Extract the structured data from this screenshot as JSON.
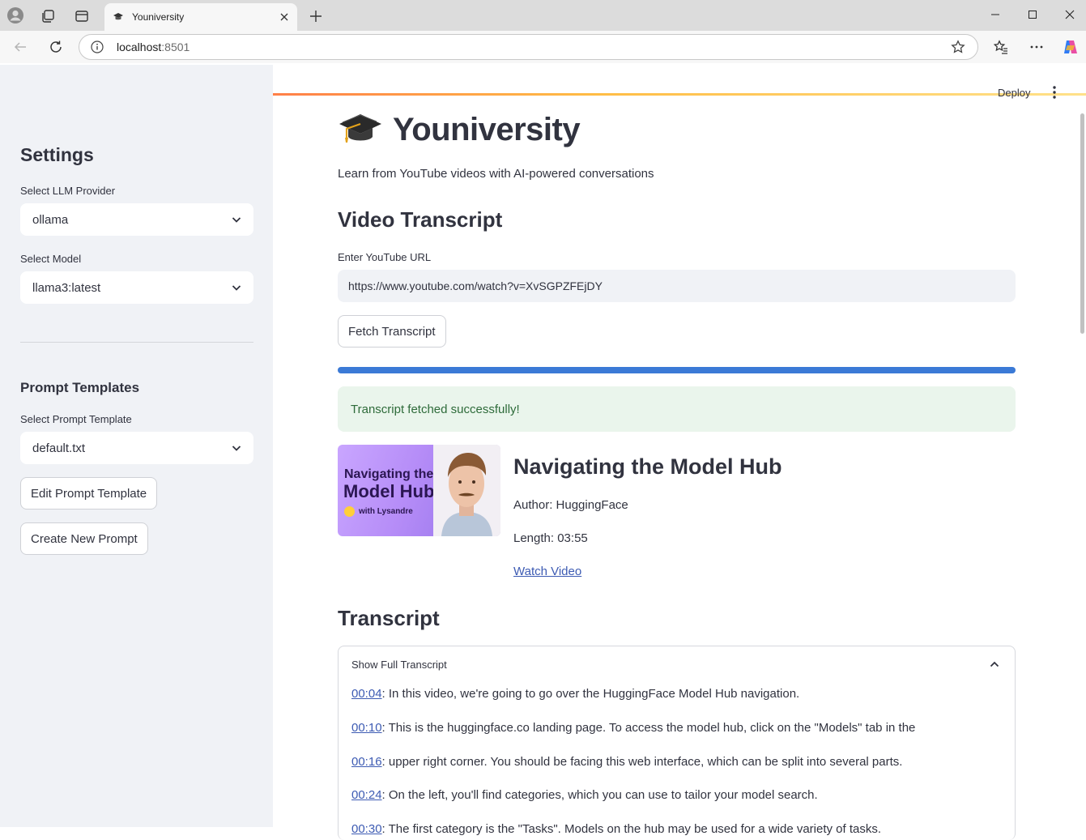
{
  "browser": {
    "tab_title": "Youniversity",
    "url_host": "localhost",
    "url_port": ":8501"
  },
  "sidebar": {
    "settings_heading": "Settings",
    "llm_provider_label": "Select LLM Provider",
    "llm_provider_value": "ollama",
    "model_label": "Select Model",
    "model_value": "llama3:latest",
    "prompt_templates_heading": "Prompt Templates",
    "prompt_template_label": "Select Prompt Template",
    "prompt_template_value": "default.txt",
    "edit_prompt_button": "Edit Prompt Template",
    "create_prompt_button": "Create New Prompt"
  },
  "header": {
    "deploy_label": "Deploy"
  },
  "main": {
    "title": "Youniversity",
    "subtitle": "Learn from YouTube videos with AI-powered conversations",
    "video_transcript_heading": "Video Transcript",
    "url_label": "Enter YouTube URL",
    "url_value": "https://www.youtube.com/watch?v=XvSGPZFEjDY",
    "fetch_button": "Fetch Transcript",
    "progress": 1.0,
    "success_message": "Transcript fetched successfully!",
    "video": {
      "thumb_line1": "Navigating the",
      "thumb_line2": "Model Hub",
      "thumb_line3": "with Lysandre",
      "title": "Navigating the Model Hub",
      "author": "Author: HuggingFace",
      "length": "Length: 03:55",
      "watch_link": "Watch Video"
    },
    "transcript_heading": "Transcript",
    "expander_label": "Show Full Transcript",
    "lines": [
      {
        "ts": "00:04",
        "text": ": In this video, we're going to go over  the HuggingFace Model Hub navigation."
      },
      {
        "ts": "00:10",
        "text": ": This is the huggingface.co landing page. To access  the model hub, click on the \"Models\" tab in the"
      },
      {
        "ts": "00:16",
        "text": ": upper right corner. You should be facing this web  interface, which can be split into several parts."
      },
      {
        "ts": "00:24",
        "text": ": On the left, you'll find categories, which  you can use to tailor your model search."
      },
      {
        "ts": "00:30",
        "text": ": The first category is the \"Tasks\". Models on the hub may be used for a wide variety of tasks."
      }
    ]
  },
  "colors": {
    "accent": "#ff4b4b",
    "progress": "#3b7ad6",
    "success_bg": "#eaf5ec",
    "link": "#3d5bb3",
    "sidebar_bg": "#f0f2f6"
  }
}
